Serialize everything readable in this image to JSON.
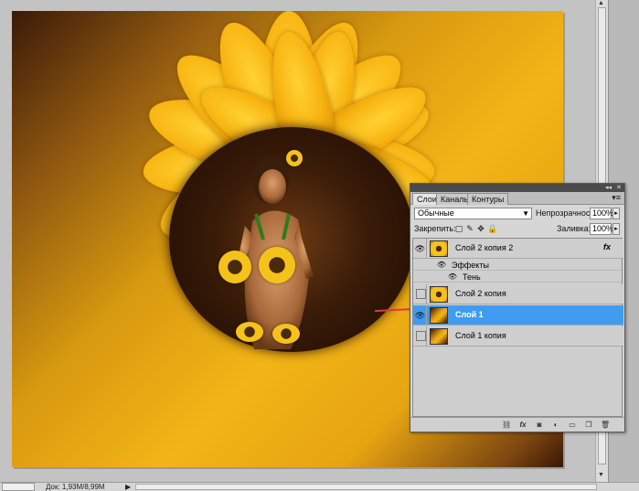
{
  "layers_panel": {
    "tabs": [
      {
        "label": "Слои"
      },
      {
        "label": "Каналы"
      },
      {
        "label": "Контуры"
      }
    ],
    "blend_mode": "Обычные",
    "opacity_label": "Непрозрачность:",
    "opacity_value": "100%",
    "lock_label": "Закрепить:",
    "fill_label": "Заливка:",
    "fill_value": "100%",
    "layers": [
      {
        "name": "Слой 2 копия 2",
        "fx": "fx",
        "effects_label": "Эффекты",
        "effect": "Тень"
      },
      {
        "name": "Слой 2 копия"
      },
      {
        "name": "Слой 1"
      },
      {
        "name": "Слой 1 копия"
      }
    ]
  },
  "statusbar": {
    "doc_info": "Док: 1,93M/8,99M"
  },
  "icons": [
    "eye-icon",
    "fx-icon",
    "link-icon",
    "mask-icon",
    "adjustment-icon",
    "folder-icon",
    "new-layer-icon",
    "trash-icon",
    "panel-menu-icon"
  ],
  "colors": {
    "selection": "#3f9cf2",
    "panel_bg": "#d6d6d6",
    "arrow": "#e23a3a"
  }
}
